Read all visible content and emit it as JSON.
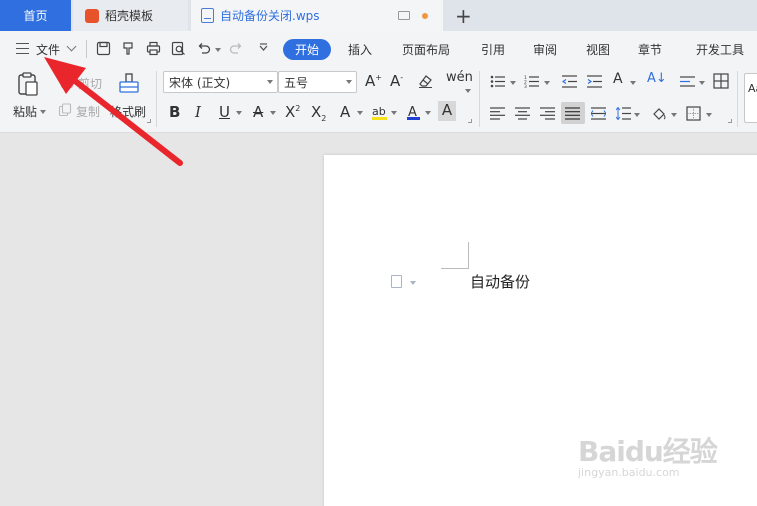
{
  "tabs": {
    "home": "首页",
    "template": "稻壳模板",
    "document": "自动备份关闭.wps",
    "add": "+"
  },
  "menu": {
    "file": "文件",
    "items": [
      "开始",
      "插入",
      "页面布局",
      "引用",
      "审阅",
      "视图",
      "章节",
      "开发工具"
    ],
    "active_index": 0
  },
  "ribbon": {
    "paste": "粘贴",
    "cut": "剪切",
    "copy": "复制",
    "format_painter": "格式刷",
    "font_name": "宋体 (正文)",
    "font_size": "五号",
    "style_preview": "Aa"
  },
  "document": {
    "text": "自动备份"
  },
  "watermark": {
    "main": "Baidu经验",
    "sub": "jingyan.baidu.com"
  },
  "colors": {
    "accent": "#2f6fdf",
    "annotation_arrow": "#e8262b",
    "template_icon": "#e8532c",
    "unsaved_dot": "#f09540"
  }
}
